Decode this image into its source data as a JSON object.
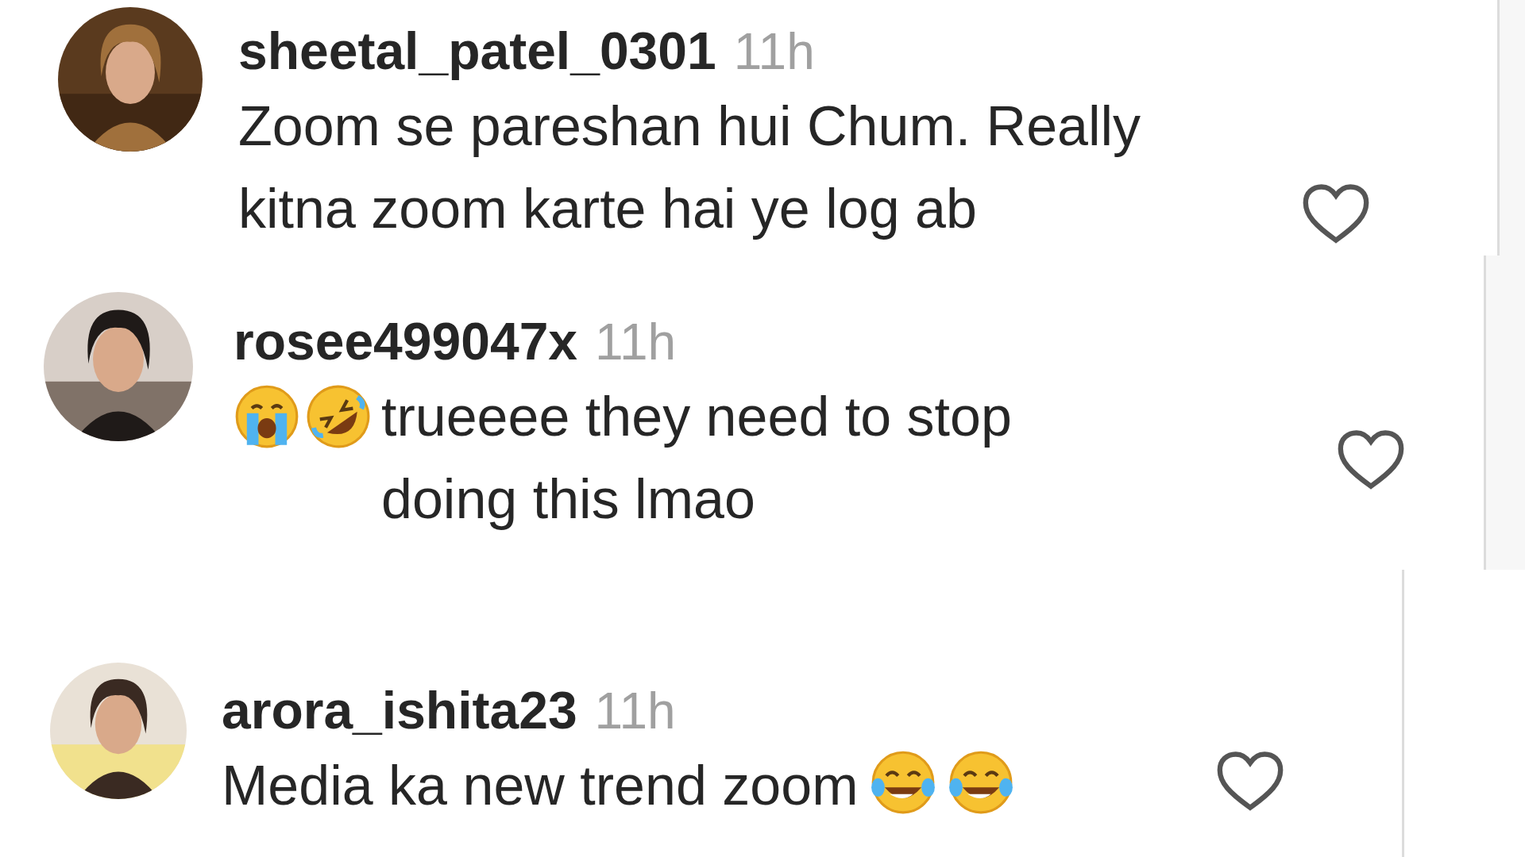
{
  "comments": [
    {
      "username": "sheetal_patel_0301",
      "time": "11h",
      "text": "Zoom se pareshan hui Chum. Really kitna zoom karte hai ye log ab",
      "liked": false,
      "avatar": {
        "kind": "picture"
      }
    },
    {
      "username": "rosee499047x",
      "time": "11h",
      "emojis_before": [
        {
          "kind": "crying"
        },
        {
          "kind": "rofl"
        }
      ],
      "text": "trueeee they need to stop doing this lmao",
      "liked": false,
      "avatar": {
        "kind": "picture"
      }
    },
    {
      "username": "arora_ishita23",
      "time": "11h",
      "text": "Media ka new trend zoom",
      "emojis_after": [
        {
          "kind": "joy"
        },
        {
          "kind": "joy"
        }
      ],
      "liked": false,
      "avatar": {
        "kind": "picture"
      }
    }
  ]
}
